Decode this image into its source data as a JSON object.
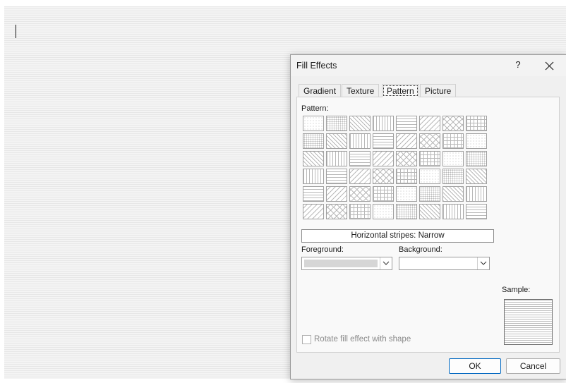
{
  "dialog": {
    "title": "Fill Effects",
    "help_label": "?",
    "tabs": [
      {
        "label": "Gradient",
        "selected": false
      },
      {
        "label": "Texture",
        "selected": false
      },
      {
        "label": "Pattern",
        "selected": true
      },
      {
        "label": "Picture",
        "selected": false
      }
    ],
    "pattern_label": "Pattern:",
    "selected_pattern_name": "Horizontal stripes: Narrow",
    "foreground_label": "Foreground:",
    "background_label": "Background:",
    "sample_label": "Sample:",
    "rotate_label": "Rotate fill effect with shape",
    "rotate_checked": false,
    "ok_label": "OK",
    "cancel_label": "Cancel",
    "colors": {
      "default_button_border": "#0067c0",
      "foreground_swatch": "#d6d6d6",
      "pattern_line": "#bdbdbd"
    }
  }
}
